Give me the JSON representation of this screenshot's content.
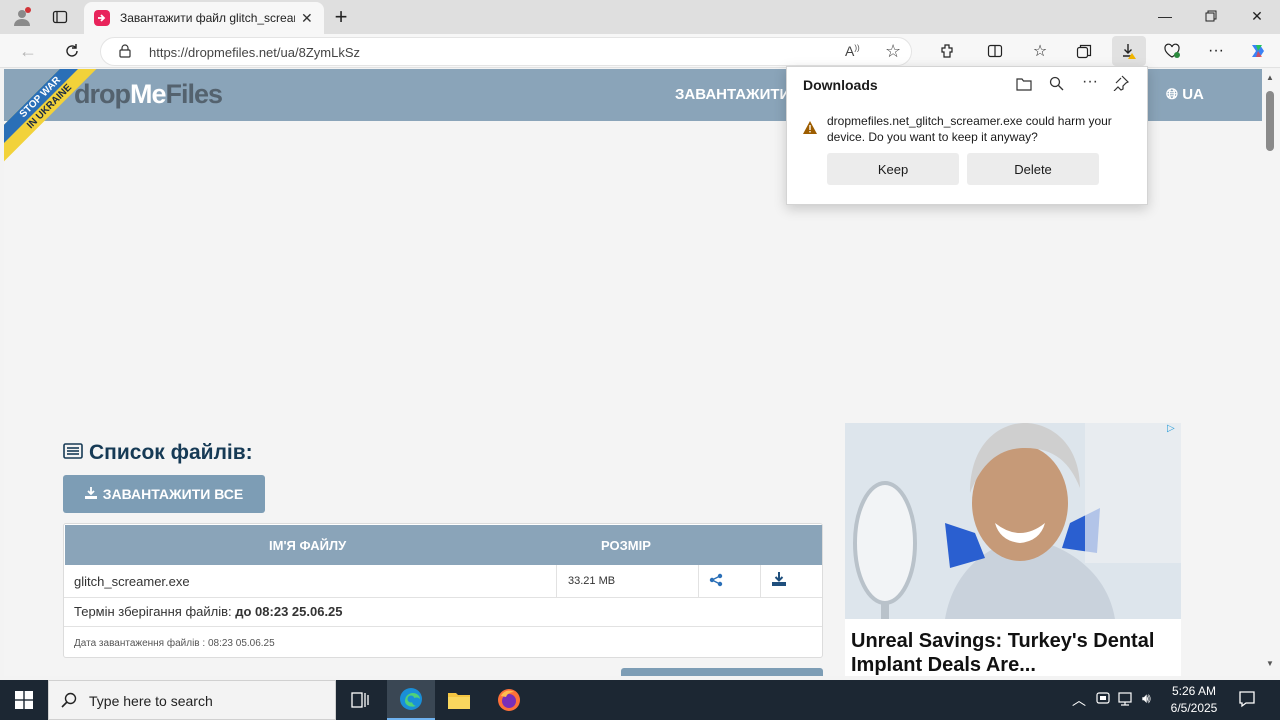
{
  "browser": {
    "tab_title": "Завантажити файл glitch_screamer.exe",
    "url": "https://dropmefiles.net/ua/8ZymLkSz"
  },
  "site": {
    "logo_drop": "drop",
    "logo_me": "Me",
    "logo_files": "Files",
    "nav_upload": "ЗАВАНТАЖИТИ",
    "nav_lang": "UA",
    "ribbon_line1": "STOP WAR",
    "ribbon_line2": "IN UKRAINE"
  },
  "files": {
    "title": "Список файлів:",
    "download_all": "ЗАВАНТАЖИТИ ВСЕ",
    "col_name": "ІМ'Я ФАЙЛУ",
    "col_size": "РОЗМІР",
    "rows": [
      {
        "name": "glitch_screamer.exe",
        "size": "33.21 MB"
      }
    ],
    "storage_label": "Термін зберігання файлів:",
    "storage_value": "до 08:23 25.06.25",
    "upload_date": "Дата завантаження файлів : 08:23 05.06.25"
  },
  "ad": {
    "headline": "Unreal Savings: Turkey's Dental Implant Deals Are..."
  },
  "downloads": {
    "title": "Downloads",
    "message": "dropmefiles.net_glitch_screamer.exe could harm your device. Do you want to keep it anyway?",
    "keep": "Keep",
    "delete": "Delete"
  },
  "taskbar": {
    "search_placeholder": "Type here to search",
    "time": "5:26 AM",
    "date": "6/5/2025"
  },
  "colors": {
    "site_bar": "#8aa4b9",
    "button": "#7d9db5",
    "warning": "#9d5d00",
    "edge_tab": "#e8245b"
  }
}
